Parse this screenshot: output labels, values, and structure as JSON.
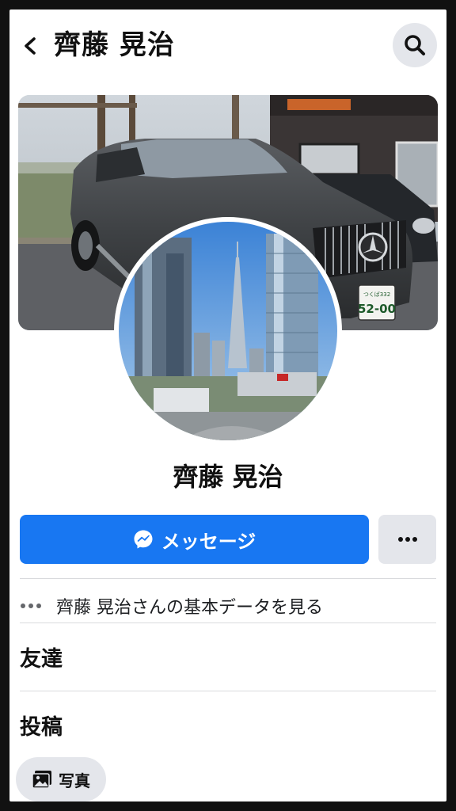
{
  "header": {
    "title": "齊藤 晃治"
  },
  "cover": {
    "plate_top": "つくば332",
    "plate_number": "52-00"
  },
  "profile": {
    "name": "齊藤 晃治"
  },
  "actions": {
    "message_label": "メッセージ"
  },
  "about": {
    "label": "齊藤 晃治さんの基本データを見る"
  },
  "sections": {
    "friends": "友達",
    "posts": "投稿"
  },
  "chips": {
    "photos": "写真"
  },
  "icons": {
    "back": "chevron-left-icon",
    "search": "search-icon",
    "messenger": "messenger-icon",
    "more": "more-dots-icon",
    "photo": "photo-icon"
  },
  "colors": {
    "accent": "#1877f2",
    "secondary_button": "#e4e6eb"
  }
}
